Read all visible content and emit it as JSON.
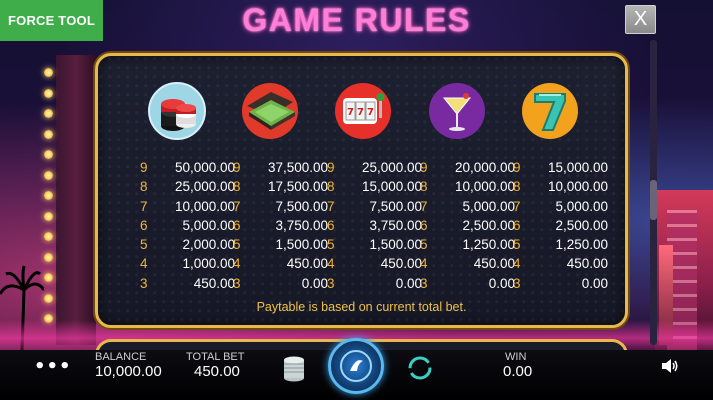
{
  "header": {
    "force_tool_label": "FORCE TOOL",
    "title": "GAME RULES",
    "close_label": "X"
  },
  "paytable": {
    "columns": [
      {
        "symbol": "casino-chips-icon",
        "rows": [
          {
            "count": "9",
            "pay": "50,000.00"
          },
          {
            "count": "8",
            "pay": "25,000.00"
          },
          {
            "count": "7",
            "pay": "10,000.00"
          },
          {
            "count": "6",
            "pay": "5,000.00"
          },
          {
            "count": "5",
            "pay": "2,000.00"
          },
          {
            "count": "4",
            "pay": "1,000.00"
          },
          {
            "count": "3",
            "pay": "450.00"
          }
        ]
      },
      {
        "symbol": "cash-briefcase-icon",
        "rows": [
          {
            "count": "9",
            "pay": "37,500.00"
          },
          {
            "count": "8",
            "pay": "17,500.00"
          },
          {
            "count": "7",
            "pay": "7,500.00"
          },
          {
            "count": "6",
            "pay": "3,750.00"
          },
          {
            "count": "5",
            "pay": "1,500.00"
          },
          {
            "count": "4",
            "pay": "450.00"
          },
          {
            "count": "3",
            "pay": "0.00"
          }
        ]
      },
      {
        "symbol": "slot-machine-icon",
        "rows": [
          {
            "count": "9",
            "pay": "25,000.00"
          },
          {
            "count": "8",
            "pay": "15,000.00"
          },
          {
            "count": "7",
            "pay": "7,500.00"
          },
          {
            "count": "6",
            "pay": "3,750.00"
          },
          {
            "count": "5",
            "pay": "1,500.00"
          },
          {
            "count": "4",
            "pay": "450.00"
          },
          {
            "count": "3",
            "pay": "0.00"
          }
        ]
      },
      {
        "symbol": "cocktail-glass-icon",
        "rows": [
          {
            "count": "9",
            "pay": "20,000.00"
          },
          {
            "count": "8",
            "pay": "10,000.00"
          },
          {
            "count": "7",
            "pay": "5,000.00"
          },
          {
            "count": "6",
            "pay": "2,500.00"
          },
          {
            "count": "5",
            "pay": "1,250.00"
          },
          {
            "count": "4",
            "pay": "450.00"
          },
          {
            "count": "3",
            "pay": "0.00"
          }
        ]
      },
      {
        "symbol": "lucky-seven-icon",
        "rows": [
          {
            "count": "9",
            "pay": "15,000.00"
          },
          {
            "count": "8",
            "pay": "10,000.00"
          },
          {
            "count": "7",
            "pay": "5,000.00"
          },
          {
            "count": "6",
            "pay": "2,500.00"
          },
          {
            "count": "5",
            "pay": "1,250.00"
          },
          {
            "count": "4",
            "pay": "450.00"
          },
          {
            "count": "3",
            "pay": "0.00"
          }
        ]
      }
    ],
    "note": "Paytable is based on current total bet."
  },
  "footer": {
    "menu_label": "•••",
    "balance_label": "BALANCE",
    "balance_value": "10,000.00",
    "total_bet_label": "TOTAL BET",
    "total_bet_value": "450.00",
    "win_label": "WIN",
    "win_value": "0.00"
  },
  "colors": {
    "title": "#ff7fd6",
    "panel_border": "#e8b94a",
    "count_text": "#f0b43a",
    "force_tool_bg": "#3fae4a"
  }
}
